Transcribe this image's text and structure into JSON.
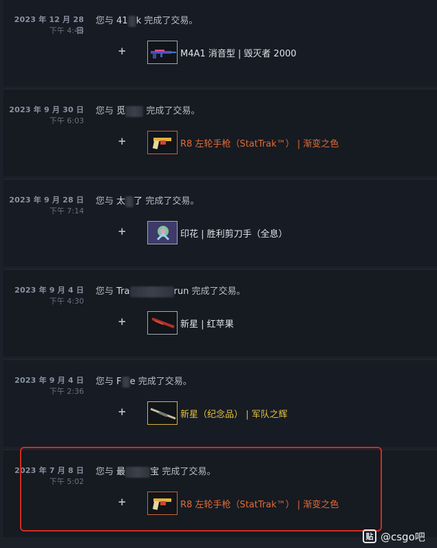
{
  "entries": [
    {
      "date": "2023 年 12 月 28 日",
      "time": "下午 4:48",
      "prefix": "您与",
      "partner_start": "41",
      "partner_end": "k",
      "suffix": "完成了交易。",
      "item_name": "M4A1 消音型 | 毁灭者 2000",
      "item_icon": "rifle-icon"
    },
    {
      "date": "2023 年 9 月 30 日",
      "time": "下午 6:03",
      "prefix": "您与",
      "partner_start": "觅",
      "partner_end": "",
      "suffix": "完成了交易。",
      "item_name": "R8 左轮手枪（StatTrak™） | 渐变之色",
      "item_icon": "revolver-icon"
    },
    {
      "date": "2023 年 9 月 28 日",
      "time": "下午 7:14",
      "prefix": "您与",
      "partner_start": "太",
      "partner_end": "了",
      "suffix": "完成了交易。",
      "item_name": "印花 | 胜利剪刀手（全息）",
      "item_icon": "sticker-icon"
    },
    {
      "date": "2023 年 9 月 4 日",
      "time": "下午 4:30",
      "prefix": "您与",
      "partner_start": "Tra",
      "partner_end": "run",
      "suffix": "完成了交易。",
      "item_name": "新星 | 红苹果",
      "item_icon": "shotgun-icon"
    },
    {
      "date": "2023 年 9 月 4 日",
      "time": "下午 2:36",
      "prefix": "您与",
      "partner_start": "F",
      "partner_end": "e",
      "suffix": "完成了交易。",
      "item_name": "新星（纪念品） | 军队之辉",
      "item_icon": "shotgun-icon"
    },
    {
      "date": "2023 年 7 月 8 日",
      "time": "下午 5:02",
      "prefix": "您与",
      "partner_start": "最",
      "partner_end": "宝",
      "suffix": "完成了交易。",
      "item_name": "R8 左轮手枪（StatTrak™） | 渐变之色",
      "item_icon": "revolver-icon"
    }
  ],
  "plus_symbol": "+",
  "watermark": {
    "icon_glyph": "贴",
    "text": "@csgo吧"
  },
  "colors": {
    "background": "#1b2029",
    "covert_item": "#e06c36",
    "souvenir_item": "#e3c13f",
    "highlight_border": "#d42a20"
  }
}
